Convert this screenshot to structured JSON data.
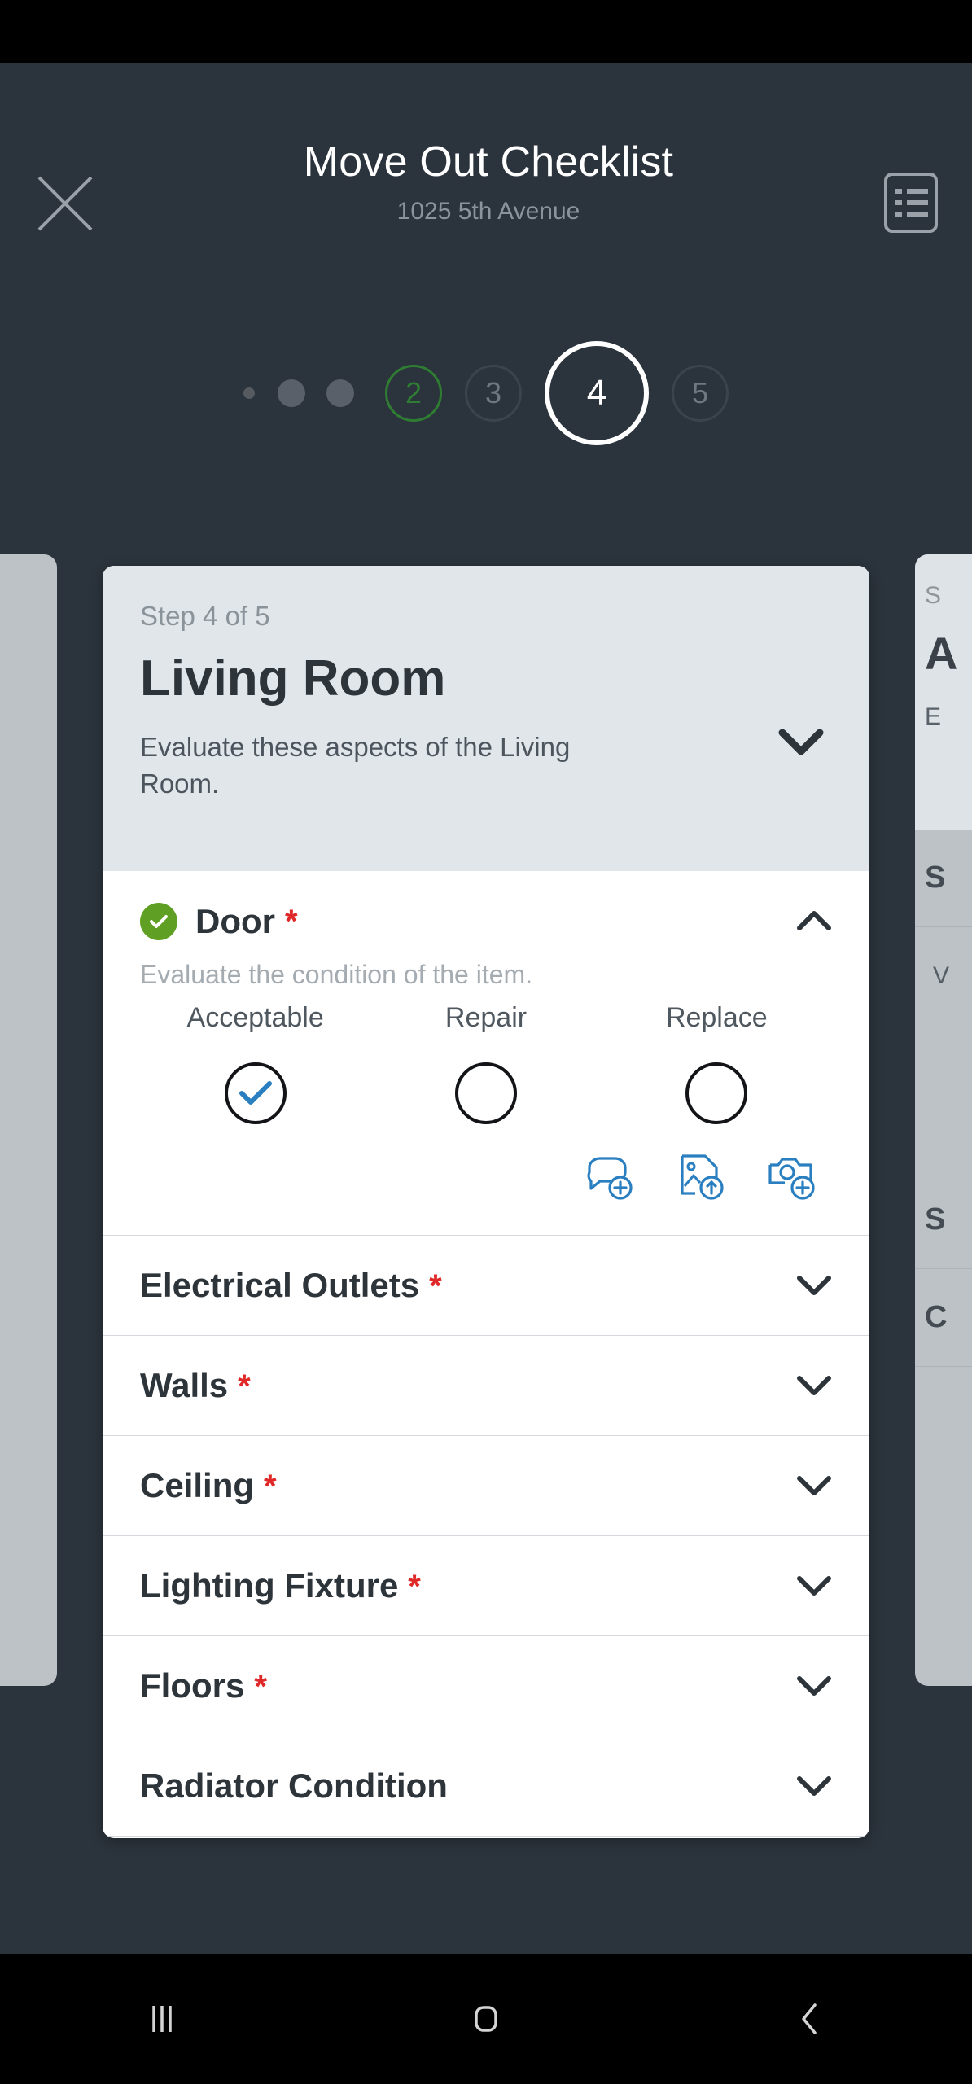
{
  "header": {
    "title": "Move Out Checklist",
    "subtitle": "1025 5th Avenue",
    "close_icon": "close-icon",
    "list_icon": "list-summary-icon"
  },
  "step_indicator": {
    "dots": [
      "dot-small",
      "dot-medium",
      "dot-medium"
    ],
    "steps": [
      {
        "label": "2",
        "state": "completed"
      },
      {
        "label": "3",
        "state": "pending"
      },
      {
        "label": "4",
        "state": "active"
      },
      {
        "label": "5",
        "state": "pending"
      }
    ]
  },
  "card": {
    "step_text": "Step 4 of 5",
    "title": "Living Room",
    "description": "Evaluate these aspects of the Living Room.",
    "collapse_icon": "chevron-down-icon"
  },
  "expanded_item": {
    "status_icon": "check-circle-icon",
    "title": "Door",
    "required_marker": "*",
    "subtitle": "Evaluate the condition of the item.",
    "collapse_icon": "chevron-up-icon",
    "options": [
      {
        "label": "Acceptable",
        "selected": true
      },
      {
        "label": "Repair",
        "selected": false
      },
      {
        "label": "Replace",
        "selected": false
      }
    ],
    "actions": [
      {
        "name": "add-comment-icon"
      },
      {
        "name": "upload-image-icon"
      },
      {
        "name": "add-photo-icon"
      }
    ]
  },
  "items": [
    {
      "label": "Electrical Outlets",
      "required_marker": "*",
      "chevron": "chevron-down-icon"
    },
    {
      "label": "Walls",
      "required_marker": "*",
      "chevron": "chevron-down-icon"
    },
    {
      "label": "Ceiling",
      "required_marker": "*",
      "chevron": "chevron-down-icon"
    },
    {
      "label": "Lighting Fixture",
      "required_marker": "*",
      "chevron": "chevron-down-icon"
    },
    {
      "label": "Floors",
      "required_marker": "*",
      "chevron": "chevron-down-icon"
    },
    {
      "label": "Radiator Condition",
      "required_marker": "",
      "chevron": "chevron-down-icon"
    }
  ],
  "peek_right": {
    "step_text": "S",
    "title": "A",
    "description": "E",
    "rows": [
      "S",
      "V",
      "S",
      "C"
    ]
  },
  "navbar": {
    "recents_icon": "recents-icon",
    "home_icon": "home-icon",
    "back_icon": "back-icon"
  },
  "colors": {
    "background": "#2b333c",
    "card_header": "#e1e6ea",
    "card_body": "#ffffff",
    "accent_blue": "#2a7fc1",
    "success_green": "#5fa024",
    "required_red": "#e02828",
    "step_done_green": "#2f7d32"
  }
}
